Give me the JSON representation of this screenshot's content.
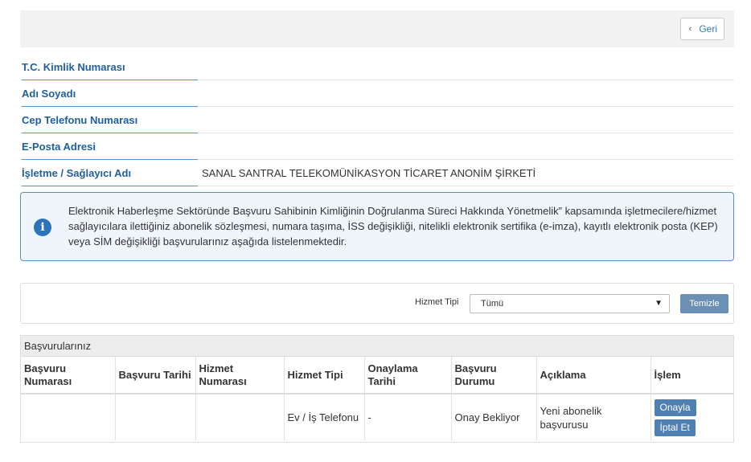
{
  "header": {
    "back_label": "Geri",
    "back_icon": "chevron-left-icon"
  },
  "info": [
    {
      "label": "T.C. Kimlik Numarası",
      "value": ""
    },
    {
      "label": "Adı Soyadı",
      "value": ""
    },
    {
      "label": "Cep Telefonu Numarası",
      "value": ""
    },
    {
      "label": "E-Posta Adresi",
      "value": ""
    },
    {
      "label": "İşletme / Sağlayıcı Adı",
      "value": "SANAL SANTRAL TELEKOMÜNİKASYON TİCARET ANONİM ŞİRKETİ"
    }
  ],
  "alert": {
    "icon": "info-icon",
    "text": "Elektronik Haberleşme Sektöründe Başvuru Sahibinin Kimliğinin Doğrulanma Süreci Hakkında Yönetmelik” kapsamında işletmecilere/hizmet sağlayıcılara ilettiğiniz abonelik sözleşmesi, numara taşıma, İSS değişikliği, nitelikli elektronik sertifika (e-imza), kayıtlı elektronik posta (KEP) veya SİM değişikliği başvurularınız aşağıda listelenmektedir."
  },
  "filter": {
    "label": "Hizmet Tipi",
    "selected": "Tümü",
    "clear_label": "Temizle"
  },
  "table": {
    "title": "Başvurularınız",
    "headers": [
      "Başvuru Numarası",
      "Başvuru Tarihi",
      "Hizmet Numarası",
      "Hizmet Tipi",
      "Onaylama Tarihi",
      "Başvuru Durumu",
      "Açıklama",
      "İşlem"
    ],
    "rows": [
      {
        "basvuru_no": "",
        "basvuru_tarihi": "",
        "hizmet_no": "",
        "hizmet_tipi": "Ev / İş Telefonu",
        "onay_tarihi": "-",
        "durum": "Onay Bekliyor",
        "aciklama": "Yeni abonelik başvurusu",
        "approve_label": "Onayla",
        "cancel_label": "İptal Et"
      }
    ]
  },
  "colors": {
    "accent": "#2d73b9",
    "label": "#1f5f9e",
    "button": "#4f7fb3"
  }
}
